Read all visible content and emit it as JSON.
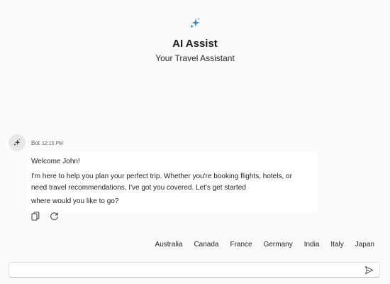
{
  "header": {
    "icon": "sparkle-icon",
    "title": "AI Assist",
    "subtitle": "Your Travel Assistant",
    "accent_color": "#3b82c4"
  },
  "message": {
    "sender": "Bot",
    "time": "12:15 PM",
    "avatar_icon": "sparkle-icon",
    "greeting": "Welcome John!",
    "line1": "I'm here to help you plan your perfect trip. Whether you're booking flights, hotels, or",
    "line2": "need travel recommendations, I've got you covered. Let's get started",
    "line3": "where would you like to go?",
    "actions": [
      "copy-icon",
      "refresh-icon"
    ]
  },
  "suggestions": [
    "Australia",
    "Canada",
    "France",
    "Germany",
    "India",
    "Italy",
    "Japan"
  ],
  "composer": {
    "placeholder": "",
    "send_icon": "send-icon"
  }
}
